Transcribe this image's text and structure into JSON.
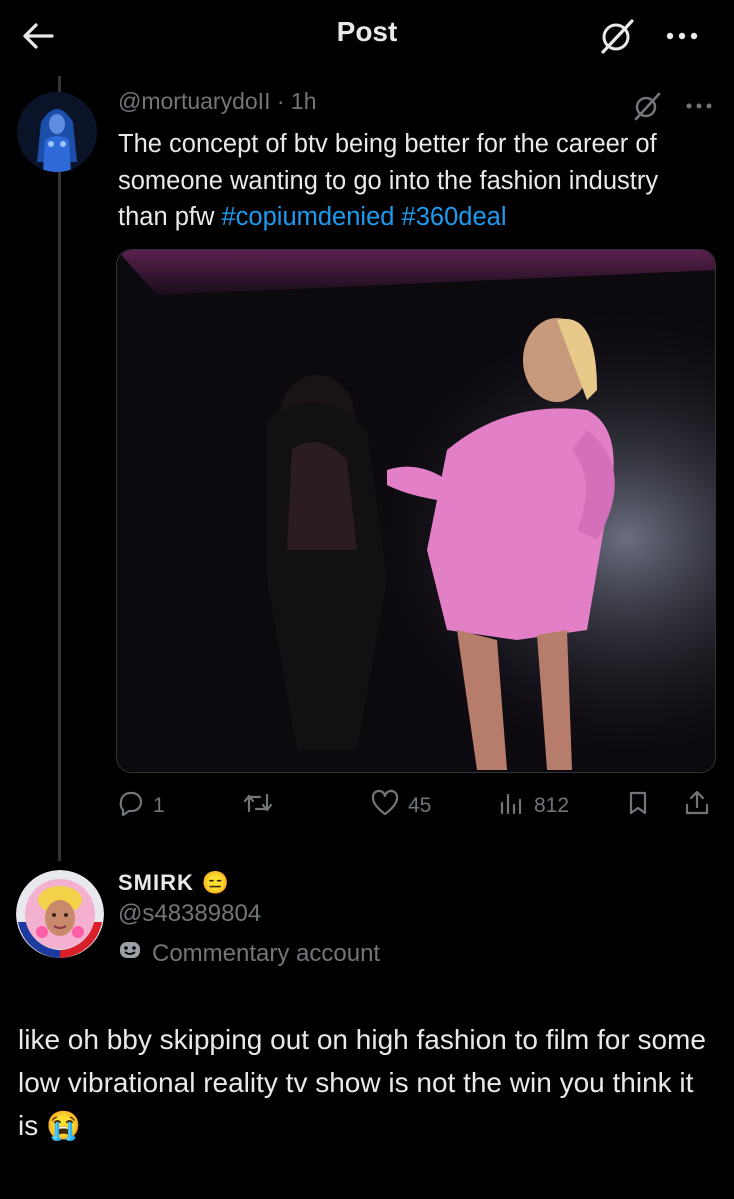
{
  "header": {
    "title": "Post"
  },
  "post": {
    "handle": "@mortuarydoII",
    "time": "1h",
    "text_plain": "The concept of btv being better for the career of someone wanting to go into the fashion industry than pfw ",
    "hashtags": [
      "#copiumdenied",
      "#360deal"
    ],
    "media": "video-still-two-performers-on-stage",
    "actions": {
      "replies": "1",
      "retweets": "",
      "likes": "45",
      "views": "812"
    }
  },
  "quote_account": {
    "name": "SMIRK",
    "name_emoji": "😑",
    "handle": "@s48389804",
    "label": "Commentary account",
    "label_icon": "theater-masks-icon"
  },
  "body_text": "like oh bby skipping out on high fashion to film for some low vibrational reality tv show is not the win you think it is",
  "body_emoji": "😭",
  "colors": {
    "link": "#1d9bf0",
    "muted": "#71767b",
    "text": "#e7e9ea",
    "background": "#000000"
  }
}
